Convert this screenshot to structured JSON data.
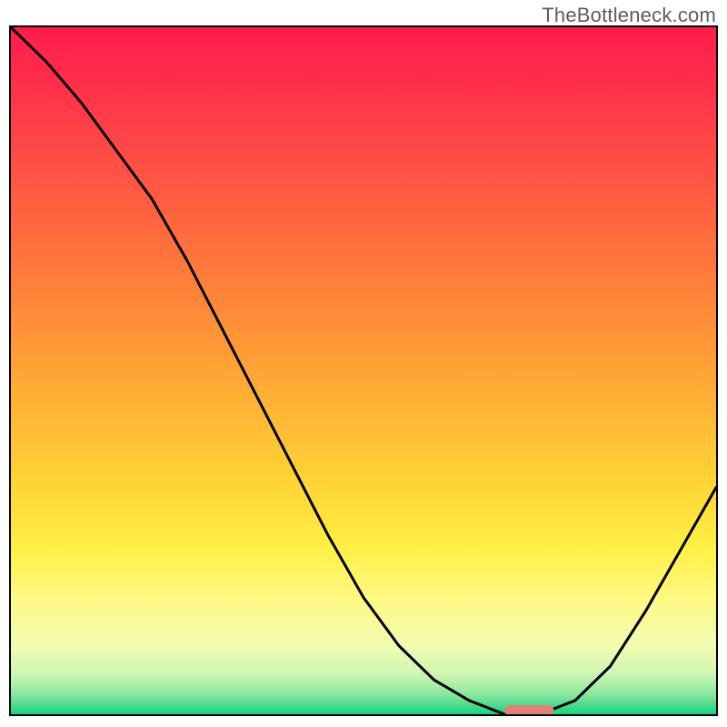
{
  "watermark": "TheBottleneck.com",
  "chart_data": {
    "type": "line",
    "title": "",
    "xlabel": "",
    "ylabel": "",
    "x": [
      0.0,
      0.05,
      0.1,
      0.15,
      0.2,
      0.25,
      0.3,
      0.35,
      0.4,
      0.45,
      0.5,
      0.55,
      0.6,
      0.65,
      0.7,
      0.75,
      0.8,
      0.85,
      0.9,
      0.95,
      1.0
    ],
    "values": [
      1.0,
      0.95,
      0.89,
      0.82,
      0.75,
      0.66,
      0.56,
      0.46,
      0.36,
      0.26,
      0.17,
      0.1,
      0.05,
      0.02,
      0.0,
      0.0,
      0.02,
      0.07,
      0.15,
      0.24,
      0.33
    ],
    "xlim": [
      0,
      1
    ],
    "ylim": [
      0,
      1
    ],
    "marker": {
      "x_range": [
        0.7,
        0.77
      ],
      "y": 0.0,
      "color": "#e08076"
    },
    "background_gradient": {
      "stops": [
        {
          "pos": 0.0,
          "color": "#ff1c4b"
        },
        {
          "pos": 0.3,
          "color": "#ff6b3e"
        },
        {
          "pos": 0.66,
          "color": "#ffd335"
        },
        {
          "pos": 0.84,
          "color": "#fdfa8a"
        },
        {
          "pos": 0.97,
          "color": "#8ee8a0"
        },
        {
          "pos": 1.0,
          "color": "#1ad07e"
        }
      ]
    }
  }
}
